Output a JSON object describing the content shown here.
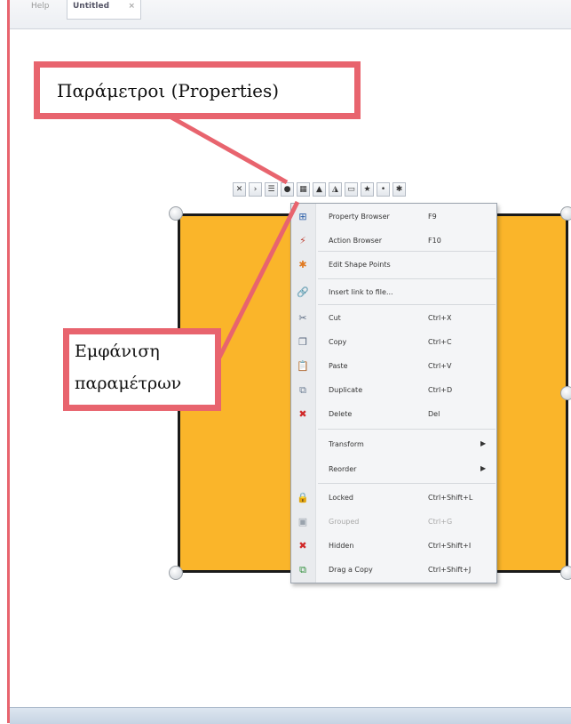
{
  "tabs": [
    {
      "label": "Help"
    },
    {
      "label": "Untitled",
      "close": "×"
    }
  ],
  "toolbar_icons": [
    "close-icon",
    "arrow-icon",
    "properties-icon",
    "circle-icon",
    "image-icon",
    "triangle-icon",
    "chart-icon",
    "shape-icon",
    "star-icon",
    "link-icon",
    "points-icon"
  ],
  "toolbar_glyphs": [
    "✕",
    "›",
    "☰",
    "●",
    "▦",
    "▲",
    "◮",
    "▭",
    "★",
    "•",
    "✱"
  ],
  "context_menu": {
    "items": [
      {
        "label": "Property Browser",
        "shortcut": "F9",
        "icon": "⊞"
      },
      {
        "label": "Action Browser",
        "shortcut": "F10",
        "icon": "⚡"
      },
      {
        "label": "Edit Shape Points",
        "shortcut": "",
        "icon": "✱"
      },
      {
        "label": "Insert link to file...",
        "shortcut": "",
        "icon": "🔗"
      },
      {
        "label": "Cut",
        "shortcut": "Ctrl+X",
        "icon": "✂"
      },
      {
        "label": "Copy",
        "shortcut": "Ctrl+C",
        "icon": "❐"
      },
      {
        "label": "Paste",
        "shortcut": "Ctrl+V",
        "icon": "📋"
      },
      {
        "label": "Duplicate",
        "shortcut": "Ctrl+D",
        "icon": "⧉"
      },
      {
        "label": "Delete",
        "shortcut": "Del",
        "icon": "✖"
      },
      {
        "label": "Transform",
        "shortcut": "",
        "icon": ""
      },
      {
        "label": "Reorder",
        "shortcut": "",
        "icon": ""
      },
      {
        "label": "Locked",
        "shortcut": "Ctrl+Shift+L",
        "icon": "🔒"
      },
      {
        "label": "Grouped",
        "shortcut": "Ctrl+G",
        "icon": "▣"
      },
      {
        "label": "Hidden",
        "shortcut": "Ctrl+Shift+I",
        "icon": "✖"
      },
      {
        "label": "Drag a Copy",
        "shortcut": "Ctrl+Shift+J",
        "icon": "⧉"
      }
    ]
  },
  "callouts": {
    "properties": "Παράμετροι (Properties)",
    "show_line1": "Εμφάνιση",
    "show_line2": "παραμέτρων"
  },
  "colors": {
    "shape_fill": "#fab52a",
    "callout_border": "#e8646e"
  }
}
